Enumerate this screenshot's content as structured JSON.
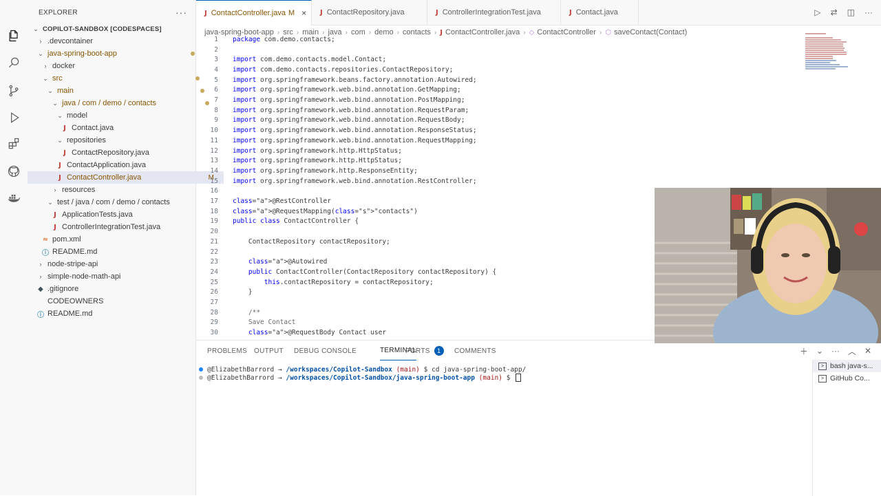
{
  "sidebar": {
    "title": "EXPLORER",
    "tree": [
      {
        "label": "COPILOT-SANDBOX [CODESPACES]",
        "indent": 0,
        "type": "root",
        "chev": "v"
      },
      {
        "label": ".devcontainer",
        "indent": 1,
        "type": "folder",
        "chev": ">"
      },
      {
        "label": "java-spring-boot-app",
        "indent": 1,
        "type": "folder",
        "chev": "v",
        "mod": true,
        "dot": true
      },
      {
        "label": "docker",
        "indent": 2,
        "type": "folder",
        "chev": ">"
      },
      {
        "label": "src",
        "indent": 2,
        "type": "folder",
        "chev": "v",
        "mod": true,
        "dot": true
      },
      {
        "label": "main",
        "indent": 3,
        "type": "folder",
        "chev": "v",
        "mod": true,
        "dot": true
      },
      {
        "label": "java / com / demo / contacts",
        "indent": 4,
        "type": "folder",
        "chev": "v",
        "mod": true,
        "dot": true
      },
      {
        "label": "model",
        "indent": 5,
        "type": "folder",
        "chev": "v"
      },
      {
        "label": "Contact.java",
        "indent": 6,
        "type": "java"
      },
      {
        "label": "repositories",
        "indent": 5,
        "type": "folder",
        "chev": "v"
      },
      {
        "label": "ContactRepository.java",
        "indent": 6,
        "type": "java"
      },
      {
        "label": "ContactApplication.java",
        "indent": 5,
        "type": "java"
      },
      {
        "label": "ContactController.java",
        "indent": 5,
        "type": "java",
        "mod": true,
        "badge": "M",
        "selected": true
      },
      {
        "label": "resources",
        "indent": 4,
        "type": "folder",
        "chev": ">"
      },
      {
        "label": "test / java / com / demo / contacts",
        "indent": 3,
        "type": "folder",
        "chev": "v"
      },
      {
        "label": "ApplicationTests.java",
        "indent": 4,
        "type": "java"
      },
      {
        "label": "ControllerIntegrationTest.java",
        "indent": 4,
        "type": "java"
      },
      {
        "label": "pom.xml",
        "indent": 2,
        "type": "xml"
      },
      {
        "label": "README.md",
        "indent": 2,
        "type": "md"
      },
      {
        "label": "node-stripe-api",
        "indent": 1,
        "type": "folder",
        "chev": ">"
      },
      {
        "label": "simple-node-math-api",
        "indent": 1,
        "type": "folder",
        "chev": ">"
      },
      {
        "label": ".gitignore",
        "indent": 1,
        "type": "git"
      },
      {
        "label": "CODEOWNERS",
        "indent": 1,
        "type": "plain"
      },
      {
        "label": "README.md",
        "indent": 1,
        "type": "md"
      }
    ]
  },
  "tabs": [
    {
      "label": "ContactController.java",
      "modified": "M",
      "close": "×",
      "active": true
    },
    {
      "label": "ContactRepository.java"
    },
    {
      "label": "ControllerIntegrationTest.java"
    },
    {
      "label": "Contact.java"
    }
  ],
  "breadcrumb": [
    "java-spring-boot-app",
    "src",
    "main",
    "java",
    "com",
    "demo",
    "contacts",
    "ContactController.java",
    "ContactController",
    "saveContact(Contact)"
  ],
  "code": [
    {
      "n": "1",
      "t": "package com.demo.contacts;"
    },
    {
      "n": "2",
      "t": ""
    },
    {
      "n": "3",
      "t": "import com.demo.contacts.model.Contact;"
    },
    {
      "n": "4",
      "t": "import com.demo.contacts.repositories.ContactRepository;"
    },
    {
      "n": "5",
      "t": "import org.springframework.beans.factory.annotation.Autowired;"
    },
    {
      "n": "6",
      "t": "import org.springframework.web.bind.annotation.GetMapping;"
    },
    {
      "n": "7",
      "t": "import org.springframework.web.bind.annotation.PostMapping;"
    },
    {
      "n": "8",
      "t": "import org.springframework.web.bind.annotation.RequestParam;"
    },
    {
      "n": "9",
      "t": "import org.springframework.web.bind.annotation.RequestBody;"
    },
    {
      "n": "10",
      "t": "import org.springframework.web.bind.annotation.ResponseStatus;"
    },
    {
      "n": "11",
      "t": "import org.springframework.web.bind.annotation.RequestMapping;"
    },
    {
      "n": "12",
      "t": "import org.springframework.http.HttpStatus;"
    },
    {
      "n": "13",
      "t": "import org.springframework.http.HttpStatus;"
    },
    {
      "n": "14",
      "t": "import org.springframework.http.ResponseEntity;"
    },
    {
      "n": "15",
      "t": "import org.springframework.web.bind.annotation.RestController;"
    },
    {
      "n": "16",
      "t": ""
    },
    {
      "n": "17",
      "t": "@RestController"
    },
    {
      "n": "18",
      "t": "@RequestMapping(\"contacts\")"
    },
    {
      "n": "19",
      "t": "public class ContactController {"
    },
    {
      "n": "20",
      "t": ""
    },
    {
      "n": "21",
      "t": "    ContactRepository contactRepository;"
    },
    {
      "n": "22",
      "t": ""
    },
    {
      "n": "23",
      "t": "    @Autowired"
    },
    {
      "n": "24",
      "t": "    public ContactController(ContactRepository contactRepository) {"
    },
    {
      "n": "25",
      "t": "        this.contactRepository = contactRepository;"
    },
    {
      "n": "26",
      "t": "    }"
    },
    {
      "n": "27",
      "t": ""
    },
    {
      "n": "28",
      "t": "    /**"
    },
    {
      "n": "29",
      "t": "    Save Contact"
    },
    {
      "n": "30",
      "t": "    @RequestBody Contact user"
    }
  ],
  "panel": {
    "tabs": [
      "PROBLEMS",
      "OUTPUT",
      "DEBUG CONSOLE",
      "TERMINAL",
      "PORTS",
      "COMMENTS"
    ],
    "active_tab": "TERMINAL",
    "ports_badge": "1",
    "terminal_lines": [
      {
        "user": "@ElizabethBarrord",
        "arrow": " → ",
        "path": "/workspaces/Copilot-Sandbox",
        "branch": " (main)",
        "prompt": " $ ",
        "cmd": "cd java-spring-boot-app/",
        "dot_color": "#1a85ff"
      },
      {
        "user": "@ElizabethBarrord",
        "arrow": " → ",
        "path": "/workspaces/Copilot-Sandbox/java-spring-boot-app",
        "branch": " (main)",
        "prompt": " $ ",
        "cmd": "",
        "dot_color": "#bbbbbb"
      }
    ],
    "terminal_list": [
      {
        "label": "bash java-s..."
      },
      {
        "label": "GitHub Co..."
      }
    ]
  },
  "colors": {
    "accent": "#005fb8",
    "modified": "#895503",
    "java_icon": "#c5403a"
  }
}
